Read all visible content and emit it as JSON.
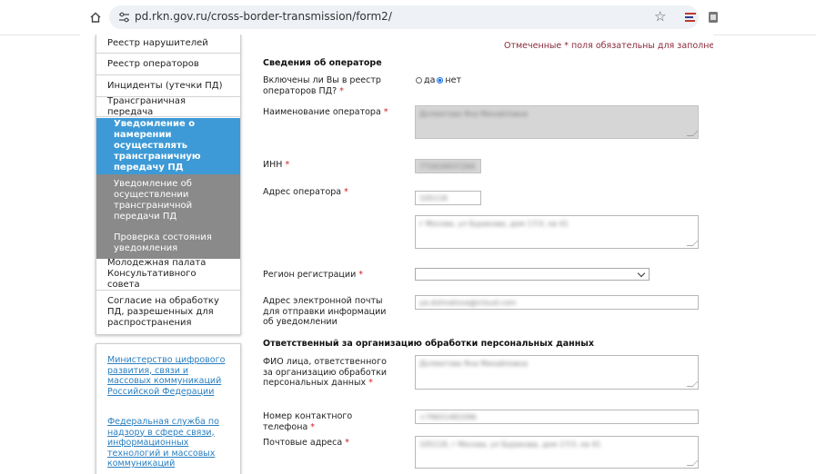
{
  "browser": {
    "url": "pd.rkn.gov.ru/cross-border-transmission/form2/"
  },
  "sidebar": {
    "items": [
      {
        "label": "Реестр нарушителей"
      },
      {
        "label": "Реестр операторов"
      },
      {
        "label": "Инциденты (утечки ПД)"
      },
      {
        "label": "Трансграничная передача"
      }
    ],
    "subitems": [
      {
        "label": "Уведомление о намерении осуществлять трансграничную передачу ПД",
        "active": true
      },
      {
        "label": "Уведомление об осуществлении трансграничной передачи ПД",
        "active": false
      },
      {
        "label": "Проверка состояния уведомления",
        "active": false
      }
    ],
    "items_after": [
      {
        "label": "Молодежная палата Консультативного совета"
      },
      {
        "label": "Согласие на обработку ПД, разрешенных для распространения"
      }
    ],
    "links": [
      {
        "label": "Министерство цифрового развития, связи и массовых коммуникаций Российской Федерации"
      },
      {
        "label": "Федеральная служба по надзору в сфере связи, информационных технологий и массовых коммуникаций"
      }
    ]
  },
  "form": {
    "required_note": "Отмеченные * поля обязательны для заполнения.",
    "section_operator": "Сведения об операторе",
    "registry_question": "Включены ли Вы в реестр операторов ПД?",
    "radio_yes": "да",
    "radio_no": "нет",
    "radio_selected": "нет",
    "operator_name_label": "Наименование оператора",
    "operator_name_value": "Долматова Яна Михайловна",
    "inn_label": "ИНН",
    "inn_value": "772618437284",
    "address_label": "Адрес оператора",
    "postcode_value": "105118",
    "address_value": "г Москва, ул Буракова, дом 17/3, кв 41",
    "region_label": "Регион регистрации",
    "region_value": "",
    "email_label": "Адрес электронной почты для отправки информации об уведомлении",
    "email_value": "ya.dolmatova@icloud.com",
    "section_responsible": "Ответственный за организацию обработки персональных данных",
    "fio_label": "ФИО лица, ответственного за организацию обработки персональных данных",
    "fio_value": "Долматова Яна Михайловна",
    "phone_label": "Номер контактного телефона",
    "phone_value": "+79651481096",
    "postal_label": "Почтовые адреса",
    "postal_value": "105118, г Москва, ул Буракова, дом 17/3, кв 41",
    "required_mark": "*"
  },
  "colors": {
    "active_sub": "#3d9ad6",
    "inactive_sub": "#8a8a8a",
    "link": "#2a7fc0",
    "required": "#cc2222"
  }
}
